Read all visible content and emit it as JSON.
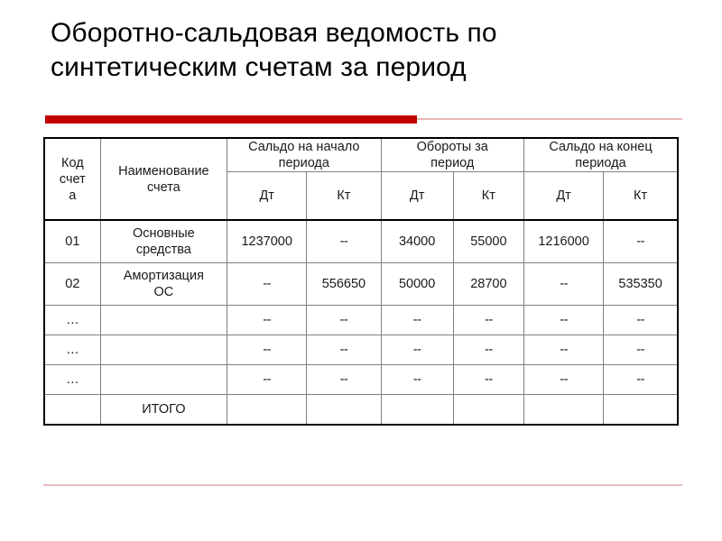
{
  "slide": {
    "title_lines": [
      "Оборотно-сальдовая ведомость по",
      "синтетическим счетам за период"
    ],
    "accent_color": "#c00000",
    "rule_light_color": "#e8b8b8"
  },
  "table": {
    "header": {
      "stub_code": "Код счет а",
      "stub_code_lines": [
        "Код",
        "счет",
        "а"
      ],
      "stub_name_lines": [
        "Наименование",
        "счета"
      ],
      "groups": [
        {
          "label_lines": [
            "Сальдо на начало",
            "периода"
          ],
          "subcolumns": [
            "Дт",
            "Кт"
          ]
        },
        {
          "label_lines": [
            "Обороты за",
            "период"
          ],
          "subcolumns": [
            "Дт",
            "Кт"
          ]
        },
        {
          "label_lines": [
            "Сальдо на конец",
            "периода"
          ],
          "subcolumns": [
            "Дт",
            "Кт"
          ]
        }
      ]
    },
    "rows": [
      {
        "code": "01",
        "name_lines": [
          "Основные",
          "средства"
        ],
        "values": [
          "1237000",
          "--",
          "34000",
          "55000",
          "1216000",
          "--"
        ]
      },
      {
        "code": "02",
        "name_lines": [
          "Амортизация",
          "ОС"
        ],
        "values": [
          "--",
          "556650",
          "50000",
          "28700",
          "--",
          "535350"
        ]
      },
      {
        "code": "…",
        "name_lines": [
          ""
        ],
        "values": [
          "--",
          "--",
          "--",
          "--",
          "--",
          "--"
        ]
      },
      {
        "code": "…",
        "name_lines": [
          ""
        ],
        "values": [
          "--",
          "--",
          "--",
          "--",
          "--",
          "--"
        ]
      },
      {
        "code": "…",
        "name_lines": [
          ""
        ],
        "values": [
          "--",
          "--",
          "--",
          "--",
          "--",
          "--"
        ]
      }
    ],
    "total_row": {
      "code": "",
      "label": "ИТОГО",
      "values": [
        "",
        "",
        "",
        "",
        "",
        ""
      ]
    }
  }
}
